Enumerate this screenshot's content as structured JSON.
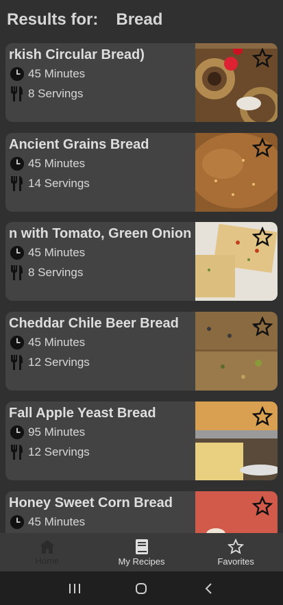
{
  "header": {
    "label": "Results for:",
    "query": "Bread"
  },
  "recipes": [
    {
      "title": "rkish Circular Bread)",
      "time": "45 Minutes",
      "servings": "8 Servings"
    },
    {
      "title": "Ancient Grains Bread",
      "time": "45 Minutes",
      "servings": "14 Servings"
    },
    {
      "title": "n with Tomato, Green Onion",
      "time": "45 Minutes",
      "servings": "8 Servings"
    },
    {
      "title": "Cheddar Chile Beer Bread",
      "time": "45 Minutes",
      "servings": "12 Servings"
    },
    {
      "title": "Fall Apple Yeast Bread",
      "time": "95 Minutes",
      "servings": "12 Servings"
    },
    {
      "title": "Honey Sweet Corn Bread",
      "time": "45 Minutes",
      "servings": ""
    }
  ],
  "nav": {
    "home": "Home",
    "my_recipes": "My Recipes",
    "favorites": "Favorites",
    "active": "home"
  },
  "icons": {
    "time": "clock-icon",
    "servings": "fork-knife-icon",
    "favorite": "star-outline-icon"
  }
}
